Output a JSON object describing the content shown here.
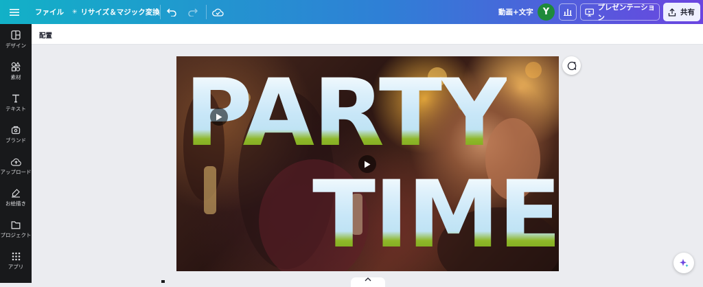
{
  "topbar": {
    "file_label": "ファイル",
    "resize_label": "リサイズ＆マジック変換",
    "doc_title": "動画+文字",
    "avatar_initial": "Y",
    "present_label": "プレゼンテーション",
    "share_label": "共有"
  },
  "sidebar": {
    "items": [
      {
        "label": "デザイン",
        "icon": "layout-icon"
      },
      {
        "label": "素材",
        "icon": "shapes-icon"
      },
      {
        "label": "テキスト",
        "icon": "text-icon"
      },
      {
        "label": "ブランド",
        "icon": "brand-icon"
      },
      {
        "label": "アップロード",
        "icon": "upload-icon"
      },
      {
        "label": "お絵描き",
        "icon": "draw-icon"
      },
      {
        "label": "プロジェクト",
        "icon": "folder-icon"
      },
      {
        "label": "アプリ",
        "icon": "apps-icon"
      }
    ]
  },
  "context_toolbar": {
    "position_label": "配置"
  },
  "canvas": {
    "line1": "PARTY",
    "line2": "TIME"
  },
  "colors": {
    "gradient_start": "#12b1c7",
    "gradient_end": "#6b45e0",
    "sidebar_bg": "#18191b",
    "avatar_bg": "#1f8a3a"
  }
}
